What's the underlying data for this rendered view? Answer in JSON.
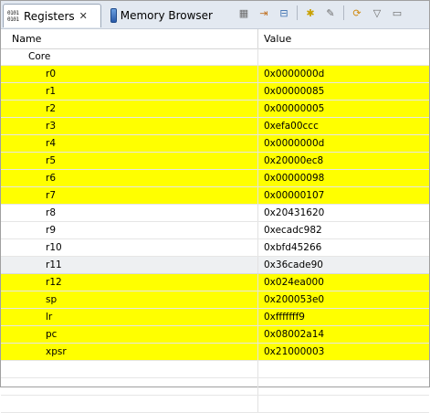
{
  "tabs": [
    {
      "label": "Registers"
    },
    {
      "label": "Memory Browser"
    }
  ],
  "register_icon_text": "0101\n0101",
  "toolbar_icons": [
    "layout-icon",
    "variables-icon",
    "collapse-all-icon",
    "new-group-icon",
    "edit-group-icon",
    "sync-icon",
    "view-menu-icon"
  ],
  "columns": {
    "name": "Name",
    "value": "Value"
  },
  "group": {
    "name": "Core"
  },
  "registers": [
    {
      "name": "r0",
      "value": "0x0000000d",
      "changed": true
    },
    {
      "name": "r1",
      "value": "0x00000085",
      "changed": true
    },
    {
      "name": "r2",
      "value": "0x00000005",
      "changed": true
    },
    {
      "name": "r3",
      "value": "0xefa00ccc",
      "changed": true
    },
    {
      "name": "r4",
      "value": "0x0000000d",
      "changed": true
    },
    {
      "name": "r5",
      "value": "0x20000ec8",
      "changed": true
    },
    {
      "name": "r6",
      "value": "0x00000098",
      "changed": true
    },
    {
      "name": "r7",
      "value": "0x00000107",
      "changed": true
    },
    {
      "name": "r8",
      "value": "0x20431620",
      "changed": false
    },
    {
      "name": "r9",
      "value": "0xecadc982",
      "changed": false
    },
    {
      "name": "r10",
      "value": "0xbfd45266",
      "changed": false
    },
    {
      "name": "r11",
      "value": "0x36cade90",
      "changed": false,
      "selected": true
    },
    {
      "name": "r12",
      "value": "0x024ea000",
      "changed": true
    },
    {
      "name": "sp",
      "value": "0x200053e0",
      "changed": true
    },
    {
      "name": "lr",
      "value": "0xfffffff9",
      "changed": true
    },
    {
      "name": "pc",
      "value": "0x08002a14",
      "changed": true
    },
    {
      "name": "xpsr",
      "value": "0x21000003",
      "changed": true
    }
  ],
  "highlight_color": "#ffff00"
}
